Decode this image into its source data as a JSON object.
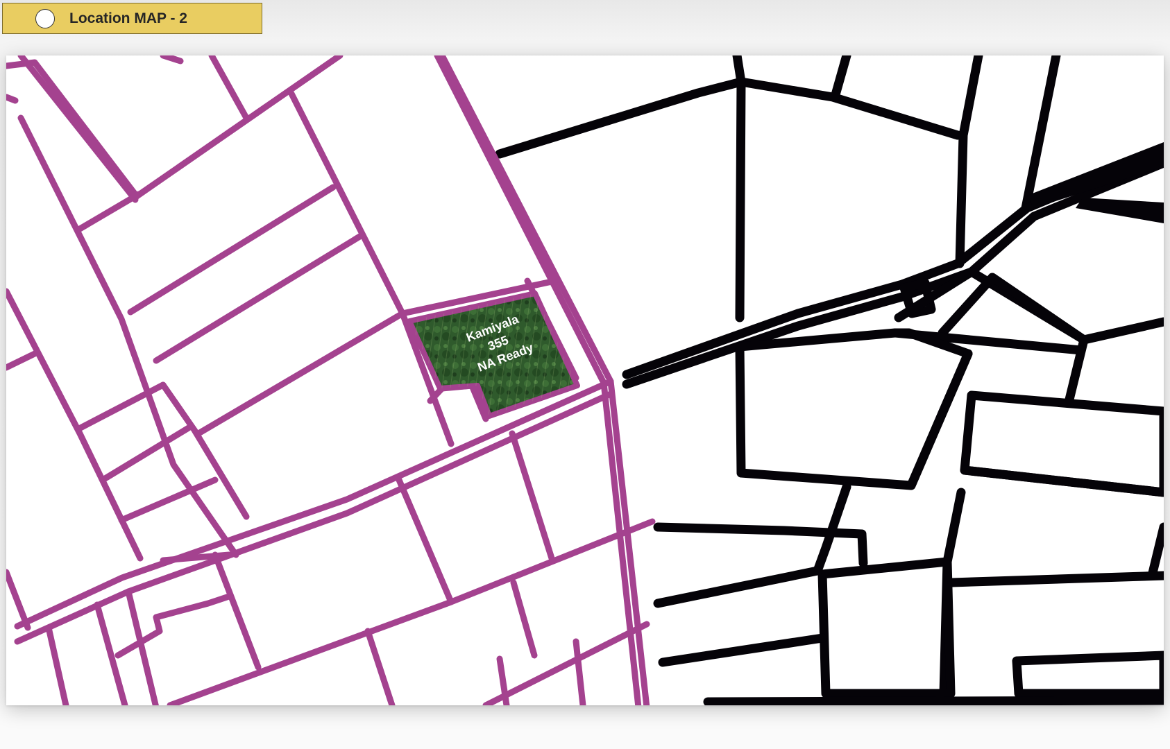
{
  "header": {
    "title": "Location MAP - 2"
  },
  "map": {
    "highlighted_plot": {
      "line1": "Kamiyala",
      "line2": "355",
      "line3": "NA Ready"
    }
  },
  "colors": {
    "title_background": "#e9cd61",
    "surveyed_boundaries": "#a4428f",
    "neighbouring_boundaries": "#000000",
    "highlighted_plot": "#2f5a2c"
  }
}
